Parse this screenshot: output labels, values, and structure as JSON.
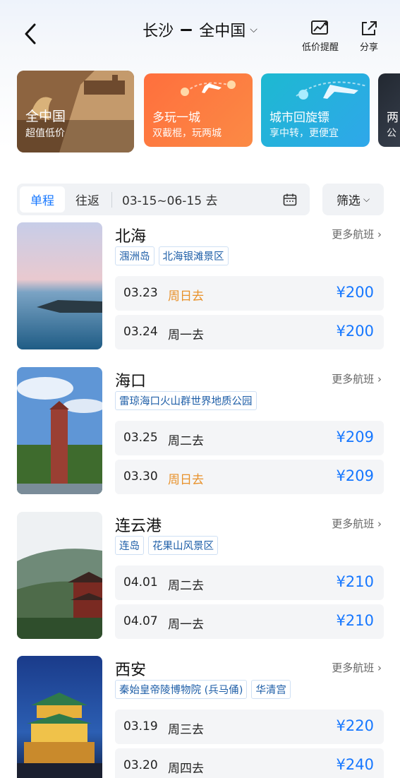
{
  "header": {
    "from": "长沙",
    "to": "全中国",
    "alert_label": "低价提醒",
    "share_label": "分享"
  },
  "categories": [
    {
      "title": "全中国",
      "subtitle": "超值低价"
    },
    {
      "title": "多玩一城",
      "subtitle": "双截棍，玩两城"
    },
    {
      "title": "城市回旋镖",
      "subtitle": "享中转，更便宜"
    },
    {
      "title": "两",
      "subtitle": "公"
    }
  ],
  "filter": {
    "one_way": "单程",
    "round_trip": "往返",
    "date_range": "03-15~06-15 去",
    "screen": "筛选"
  },
  "more_label": "更多航班",
  "destinations": [
    {
      "name": "北海",
      "tags": [
        "涠洲岛",
        "北海银滩景区"
      ],
      "flights": [
        {
          "date": "03.23",
          "day": "周日去",
          "price": "¥200",
          "weekend": true
        },
        {
          "date": "03.24",
          "day": "周一去",
          "price": "¥200",
          "weekend": false
        }
      ]
    },
    {
      "name": "海口",
      "tags": [
        "雷琼海口火山群世界地质公园"
      ],
      "flights": [
        {
          "date": "03.25",
          "day": "周二去",
          "price": "¥209",
          "weekend": false
        },
        {
          "date": "03.30",
          "day": "周日去",
          "price": "¥209",
          "weekend": true
        }
      ]
    },
    {
      "name": "连云港",
      "tags": [
        "连岛",
        "花果山风景区"
      ],
      "flights": [
        {
          "date": "04.01",
          "day": "周二去",
          "price": "¥210",
          "weekend": false
        },
        {
          "date": "04.07",
          "day": "周一去",
          "price": "¥210",
          "weekend": false
        }
      ]
    },
    {
      "name": "西安",
      "tags": [
        "秦始皇帝陵博物院 (兵马俑)",
        "华清宫"
      ],
      "flights": [
        {
          "date": "03.19",
          "day": "周三去",
          "price": "¥220",
          "weekend": false
        },
        {
          "date": "03.20",
          "day": "周四去",
          "price": "¥240",
          "weekend": false
        }
      ]
    }
  ],
  "colors": {
    "accent": "#1677ff",
    "weekend": "#e8912a"
  }
}
